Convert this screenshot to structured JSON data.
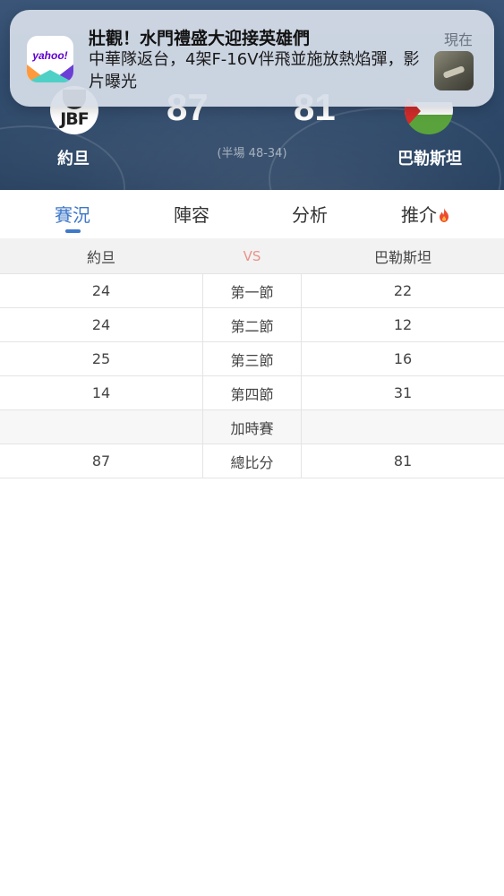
{
  "notification": {
    "app_name_logo": "yahoo!",
    "title": "壯觀！水門禮盛大迎接英雄們",
    "body": "中華隊返台，4架F-16V伴飛並施放熱焰彈，影片曝光",
    "time": "現在"
  },
  "match": {
    "home": {
      "name": "約旦",
      "score": "87",
      "logo_text": "JBF"
    },
    "away": {
      "name": "巴勒斯坦",
      "score": "81"
    },
    "halftime": "(半場 48-34)"
  },
  "tabs": [
    {
      "label": "賽況",
      "active": true
    },
    {
      "label": "陣容",
      "active": false
    },
    {
      "label": "分析",
      "active": false
    },
    {
      "label": "推介",
      "active": false
    }
  ],
  "table": {
    "header": {
      "home": "約旦",
      "vs": "VS",
      "away": "巴勒斯坦"
    },
    "rows": [
      {
        "home": "24",
        "period": "第一節",
        "away": "22"
      },
      {
        "home": "24",
        "period": "第二節",
        "away": "12"
      },
      {
        "home": "25",
        "period": "第三節",
        "away": "16"
      },
      {
        "home": "14",
        "period": "第四節",
        "away": "31"
      },
      {
        "home": "",
        "period": "加時賽",
        "away": ""
      },
      {
        "home": "87",
        "period": "總比分",
        "away": "81"
      }
    ]
  },
  "colors": {
    "accent": "#3f78c9",
    "vs": "#e9938a",
    "hero_bg": "#2f4a6c"
  }
}
